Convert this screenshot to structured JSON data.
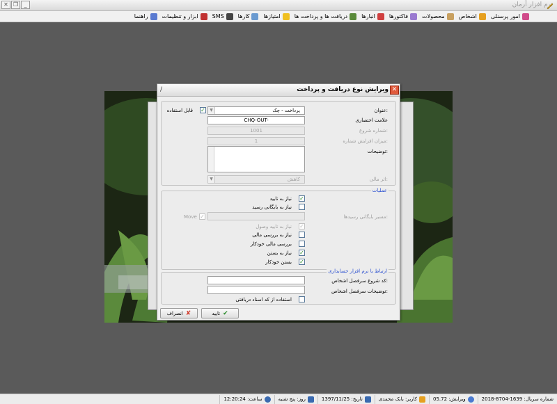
{
  "app": {
    "title": "نرم افزار آرمان",
    "window_buttons": [
      "✕",
      "❐",
      "_"
    ]
  },
  "menu": [
    {
      "label": "امور پرسنلی",
      "icon": "people-icon",
      "color": "#d04a8a"
    },
    {
      "label": "اشخاص",
      "icon": "person-icon",
      "color": "#e6a020"
    },
    {
      "label": "محصولات",
      "icon": "box-icon",
      "color": "#c8a060"
    },
    {
      "label": "فاکتورها",
      "icon": "invoice-icon",
      "color": "#9a7ad0"
    },
    {
      "label": "انبارها",
      "icon": "warehouse-icon",
      "color": "#d04040"
    },
    {
      "label": "دریافت ها و پرداخت ها",
      "icon": "money-icon",
      "color": "#5a8a3a"
    },
    {
      "label": "امتیازها",
      "icon": "star-icon",
      "color": "#f0c020"
    },
    {
      "label": "کارها",
      "icon": "tasks-icon",
      "color": "#6a9ad0"
    },
    {
      "label": "SMS",
      "icon": "sms-icon",
      "color": "#444444"
    },
    {
      "label": "ابزار و تنظیمات",
      "icon": "tools-icon",
      "color": "#c03030"
    },
    {
      "label": "راهنما",
      "icon": "help-icon",
      "color": "#5a7ad0"
    }
  ],
  "dialog": {
    "title": "ویرایش نوع دریافت و پرداخت",
    "title_mark": "/",
    "close_label": "✕",
    "fields": {
      "title_label": "عنوان:",
      "title_value": "پرداخت - چک",
      "usable_label": "قابل استفاده",
      "usable_checked": true,
      "abbr_label": "علامت اختصاری",
      "abbr_value": "CHQ-OUT-",
      "start_number_label": "شماره شروع:",
      "start_number_value": "1001",
      "increment_label": "میزان افزایش شماره:",
      "increment_value": "1",
      "description_label": "توضیحات:",
      "financial_effect_label": "اثر مالی:",
      "financial_effect_value": "کاهش",
      "dropdown_arrow": "▼"
    },
    "operations": {
      "legend": "عملیات",
      "items": [
        {
          "label": "نیاز به تایید",
          "checked": true,
          "disabled": false
        },
        {
          "label": "نیاز به بایگانی رسید",
          "checked": false,
          "disabled": false
        },
        {
          "label": "نیاز به تایید وصول",
          "checked": true,
          "disabled": true
        },
        {
          "label": "نیاز به بررسی مالی",
          "checked": false,
          "disabled": false
        },
        {
          "label": "بررسی مالی خودکار",
          "checked": false,
          "disabled": false
        },
        {
          "label": "نیاز به بستن",
          "checked": true,
          "disabled": false
        },
        {
          "label": "بستن خودکار",
          "checked": true,
          "disabled": false
        }
      ],
      "archive_path_label": "مسیر بایگانی رسیدها:",
      "move_label": "Move",
      "move_checked": true
    },
    "accounting": {
      "legend": "ارتباط با نرم افزار حسابداری",
      "start_code_label": "کد شروع سرفصل اشخاص:",
      "desc_label": "توضیحات سرفصل اشخاص:",
      "use_receipt_code_label": "استفاده از کد اسناد دریافتی"
    },
    "buttons": {
      "ok_label": "تایید",
      "ok_icon": "✔",
      "cancel_label": "انصراف",
      "cancel_icon": "✘"
    }
  },
  "status": [
    {
      "label": "شماره سریال: 1639-8704-2018",
      "icon": ""
    },
    {
      "label": "ویرایش: 05.72",
      "icon": "globe-icon",
      "color": "#4a7ad0"
    },
    {
      "label": "کاربر: بابک محمدی",
      "icon": "user-icon",
      "color": "#e6a020"
    },
    {
      "label": "تاریخ: 1397/11/25",
      "icon": "calendar-icon",
      "color": "#3a6ab0"
    },
    {
      "label": "روز: پنج شنبه",
      "icon": "day-icon",
      "color": "#3a6ab0"
    },
    {
      "label": "ساعت: 12:20:24",
      "icon": "clock-icon",
      "color": "#3a6ab0"
    }
  ],
  "colors": {
    "accent_blue": "#2a4fd0",
    "check_green": "#2a8a2a",
    "close_red": "#e05a3c"
  }
}
